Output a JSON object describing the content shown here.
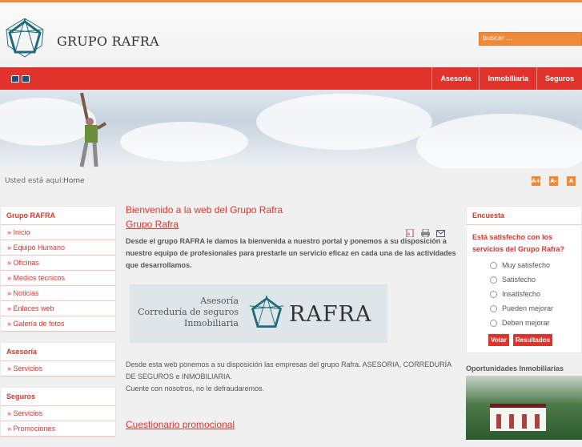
{
  "header": {
    "brand": "GRUPO RAFRA",
    "search_placeholder": "buscar ..."
  },
  "nav": {
    "items": [
      "Asesoría",
      "Inmobiliaria",
      "Seguros"
    ]
  },
  "breadcrumb": {
    "label": "Usted está aquí:",
    "home": "Home"
  },
  "font_sizes": [
    "A+",
    "A-",
    "A"
  ],
  "left": {
    "grupo": {
      "title": "Grupo RAFRA",
      "items": [
        "Inicio",
        "Equipo Humano",
        "Oficinas",
        "Medios técnicos",
        "Noticias",
        "Enlaces web",
        "Galería de fotos"
      ]
    },
    "asesoria": {
      "title": "Asesoría",
      "items": [
        "Servicios"
      ]
    },
    "seguros": {
      "title": "Seguros",
      "items": [
        "Servicios",
        "Promociones"
      ]
    }
  },
  "main": {
    "title": "Bienvenido a la web del Grupo Rafra",
    "subtitle": "Grupo Rafra",
    "intro": "Desde el grupo RAFRA le damos la bienvenida a nuestro portal y ponemos a su disposición a nuestro equipo de profesionales para prestarle un servicio eficaz en cada una de las actividades que desarrollamos.",
    "banner": {
      "line1": "Asesoría",
      "line2": "Correduría de seguros",
      "line3": "Inmobiliaria",
      "brand": "RAFRA"
    },
    "body1": "Desde esta web ponemos a su disposición las empresas del grupo Rafra. ASESORIA, CORREDURÍA DE SEGUROS e INMOBILIARIA.",
    "body2": "Cuente con nosotros, no le defraudaremos.",
    "next_title": "Cuestionario promocional"
  },
  "poll": {
    "title": "Encuesta",
    "question": "Está satisfecho con los servicios del Grupo Rafra?",
    "options": [
      "Muy satisfecho",
      "Satisfecho",
      "Insatisfecho",
      "Pueden mejorar",
      "Deben mejorar"
    ],
    "vote": "Votar",
    "results": "Resultados"
  },
  "opportunities": {
    "title": "Oportunidades Inmobiliarias"
  },
  "colors": {
    "accent_red": "#e0332b",
    "accent_orange": "#ef8a3a"
  }
}
